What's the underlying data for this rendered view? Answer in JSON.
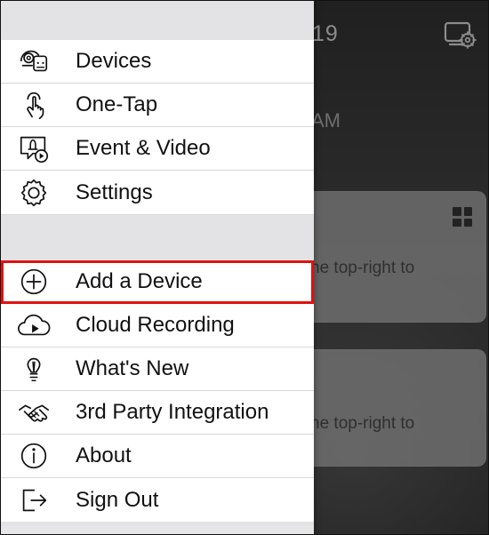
{
  "background": {
    "time_fragment": "19",
    "ampm_fragment": "AM",
    "cards": [
      {
        "text": "he top-right to"
      },
      {
        "text": "he top-right to"
      }
    ],
    "icons": [
      "camera-settings-icon",
      "grid-view-icon"
    ]
  },
  "drawer": {
    "primary_items": [
      {
        "label": "Devices",
        "icon": "devices-icon"
      },
      {
        "label": "One-Tap",
        "icon": "tap-hand-icon"
      },
      {
        "label": "Event & Video",
        "icon": "event-video-icon"
      },
      {
        "label": "Settings",
        "icon": "settings-gear-icon"
      }
    ],
    "secondary_items": [
      {
        "label": "Add a Device",
        "icon": "add-circle-icon",
        "highlighted": true
      },
      {
        "label": "Cloud Recording",
        "icon": "cloud-play-icon"
      },
      {
        "label": "What's New",
        "icon": "lightbulb-icon"
      },
      {
        "label": "3rd Party Integration",
        "icon": "handshake-icon"
      },
      {
        "label": "About",
        "icon": "info-icon"
      },
      {
        "label": "Sign Out",
        "icon": "sign-out-icon"
      }
    ]
  },
  "colors": {
    "drawer_background": "#e6e6e8",
    "menu_background": "#ffffff",
    "highlight_border": "#df1111",
    "text": "#111111"
  }
}
